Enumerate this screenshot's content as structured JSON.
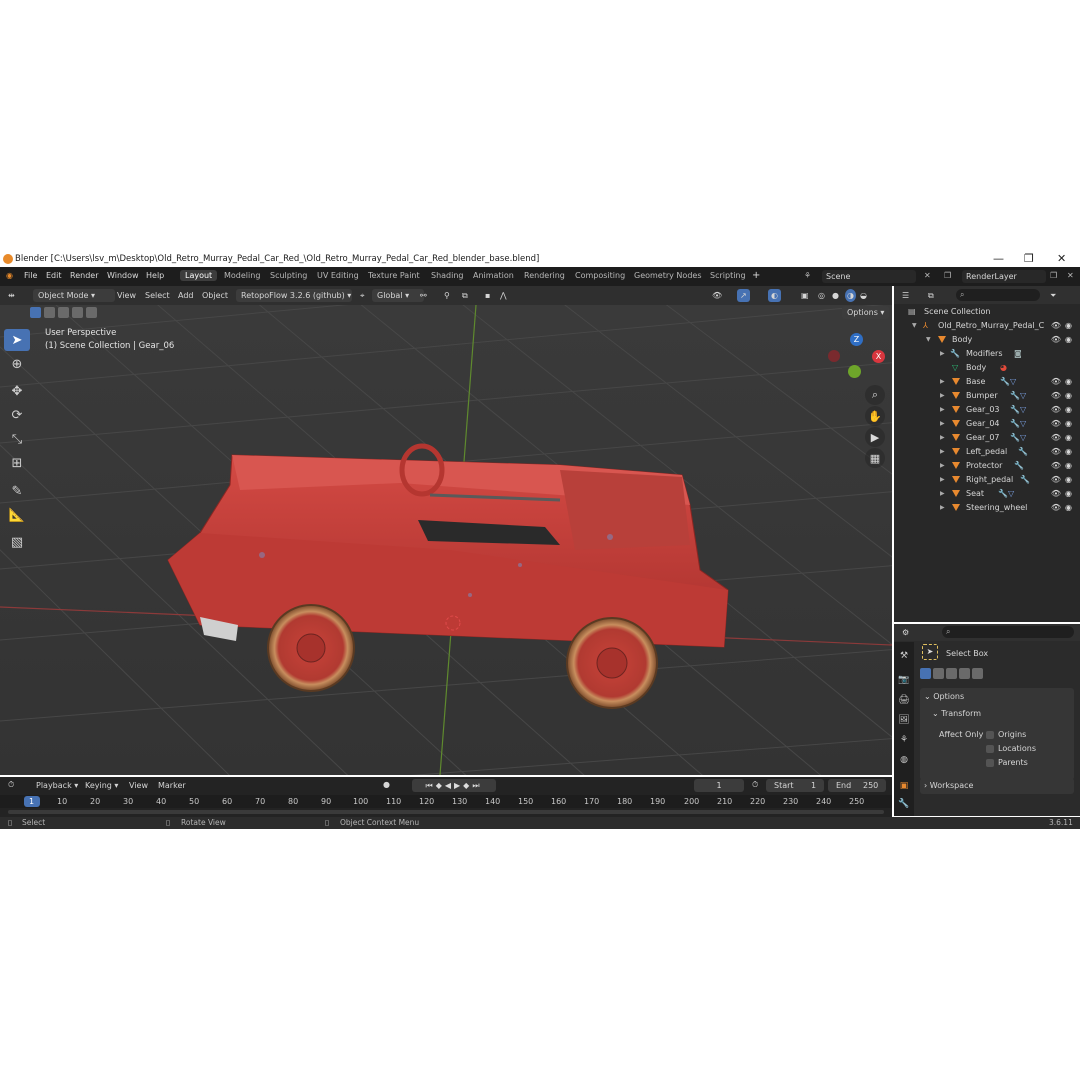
{
  "window": {
    "title": "Blender [C:\\Users\\lsv_m\\Desktop\\Old_Retro_Murray_Pedal_Car_Red_\\Old_Retro_Murray_Pedal_Car_Red_blender_base.blend]",
    "minimize": "—",
    "maximize": "❐",
    "close": "✕"
  },
  "menu": [
    "File",
    "Edit",
    "Render",
    "Window",
    "Help"
  ],
  "workspaces": [
    "Layout",
    "Modeling",
    "Sculpting",
    "UV Editing",
    "Texture Paint",
    "Shading",
    "Animation",
    "Rendering",
    "Compositing",
    "Geometry Nodes",
    "Scripting"
  ],
  "active_workspace": "Layout",
  "scene": {
    "label": "Scene"
  },
  "render_layer": {
    "label": "RenderLayer"
  },
  "viewport_header": {
    "mode": "Object Mode",
    "menus": [
      "View",
      "Select",
      "Add",
      "Object"
    ],
    "addon": "RetopoFlow 3.2.6 (github)",
    "orientation": "Global",
    "options": "Options"
  },
  "viewport": {
    "perspective": "User Perspective",
    "collection_info": "(1) Scene Collection | Gear_06",
    "gizmo": {
      "z": "Z",
      "x": "X",
      "y": "Y"
    }
  },
  "outliner": {
    "root": "Scene Collection",
    "collection": "Old_Retro_Murray_Pedal_C",
    "body": "Body",
    "modifiers": "Modifiers",
    "body_mesh": "Body",
    "objects": [
      "Base",
      "Bumper",
      "Gear_03",
      "Gear_04",
      "Gear_07",
      "Left_pedal",
      "Protector",
      "Right_pedal",
      "Seat",
      "Steering_wheel"
    ]
  },
  "properties": {
    "tool_name": "Select Box",
    "options": "Options",
    "transform": "Transform",
    "affect_only": "Affect Only",
    "checkboxes": [
      "Origins",
      "Locations",
      "Parents"
    ],
    "workspace": "Workspace"
  },
  "timeline": {
    "menus": [
      "Playback",
      "Keying",
      "View",
      "Marker"
    ],
    "current_frame": "1",
    "start_label": "Start",
    "start": "1",
    "end_label": "End",
    "end": "250",
    "ticks": [
      "1",
      "10",
      "20",
      "30",
      "40",
      "50",
      "60",
      "70",
      "80",
      "90",
      "100",
      "110",
      "120",
      "130",
      "140",
      "150",
      "160",
      "170",
      "180",
      "190",
      "200",
      "210",
      "220",
      "230",
      "240",
      "250"
    ]
  },
  "statusbar": {
    "select": "Select",
    "rotate": "Rotate View",
    "context": "Object Context Menu",
    "version": "3.6.11"
  },
  "colors": {
    "accent": "#4772b3",
    "object_icon": "#e8892f",
    "car_red": "#c43a36"
  }
}
